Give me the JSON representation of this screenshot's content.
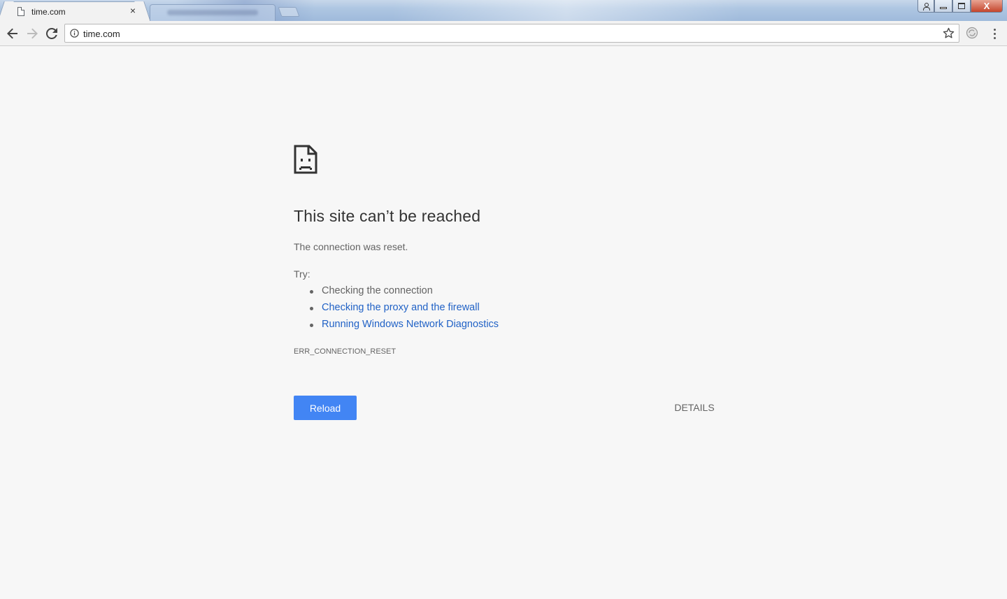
{
  "browser": {
    "active_tab": {
      "title": "time.com",
      "close_label": "×"
    },
    "address_bar": {
      "url": "time.com"
    },
    "window_controls": {
      "close_label": "X"
    }
  },
  "error_page": {
    "title": "This site can’t be reached",
    "subtitle": "The connection was reset.",
    "try_label": "Try:",
    "suggestions": [
      {
        "text": "Checking the connection",
        "is_link": false
      },
      {
        "text": "Checking the proxy and the firewall",
        "is_link": true
      },
      {
        "text": "Running Windows Network Diagnostics",
        "is_link": true
      }
    ],
    "error_code": "ERR_CONNECTION_RESET",
    "reload_label": "Reload",
    "details_label": "DETAILS"
  },
  "colors": {
    "accent": "#4285f4",
    "link": "#2162c6",
    "text_secondary": "#646464",
    "page_background": "#f7f7f7"
  },
  "icons": {
    "tab_favicon": "page-icon",
    "back": "back-arrow-icon",
    "forward": "forward-arrow-icon",
    "reload": "reload-icon",
    "site_info": "info-icon",
    "bookmark": "star-icon",
    "extension": "extension-icon",
    "menu": "kebab-menu-icon",
    "error": "sad-document-icon"
  }
}
